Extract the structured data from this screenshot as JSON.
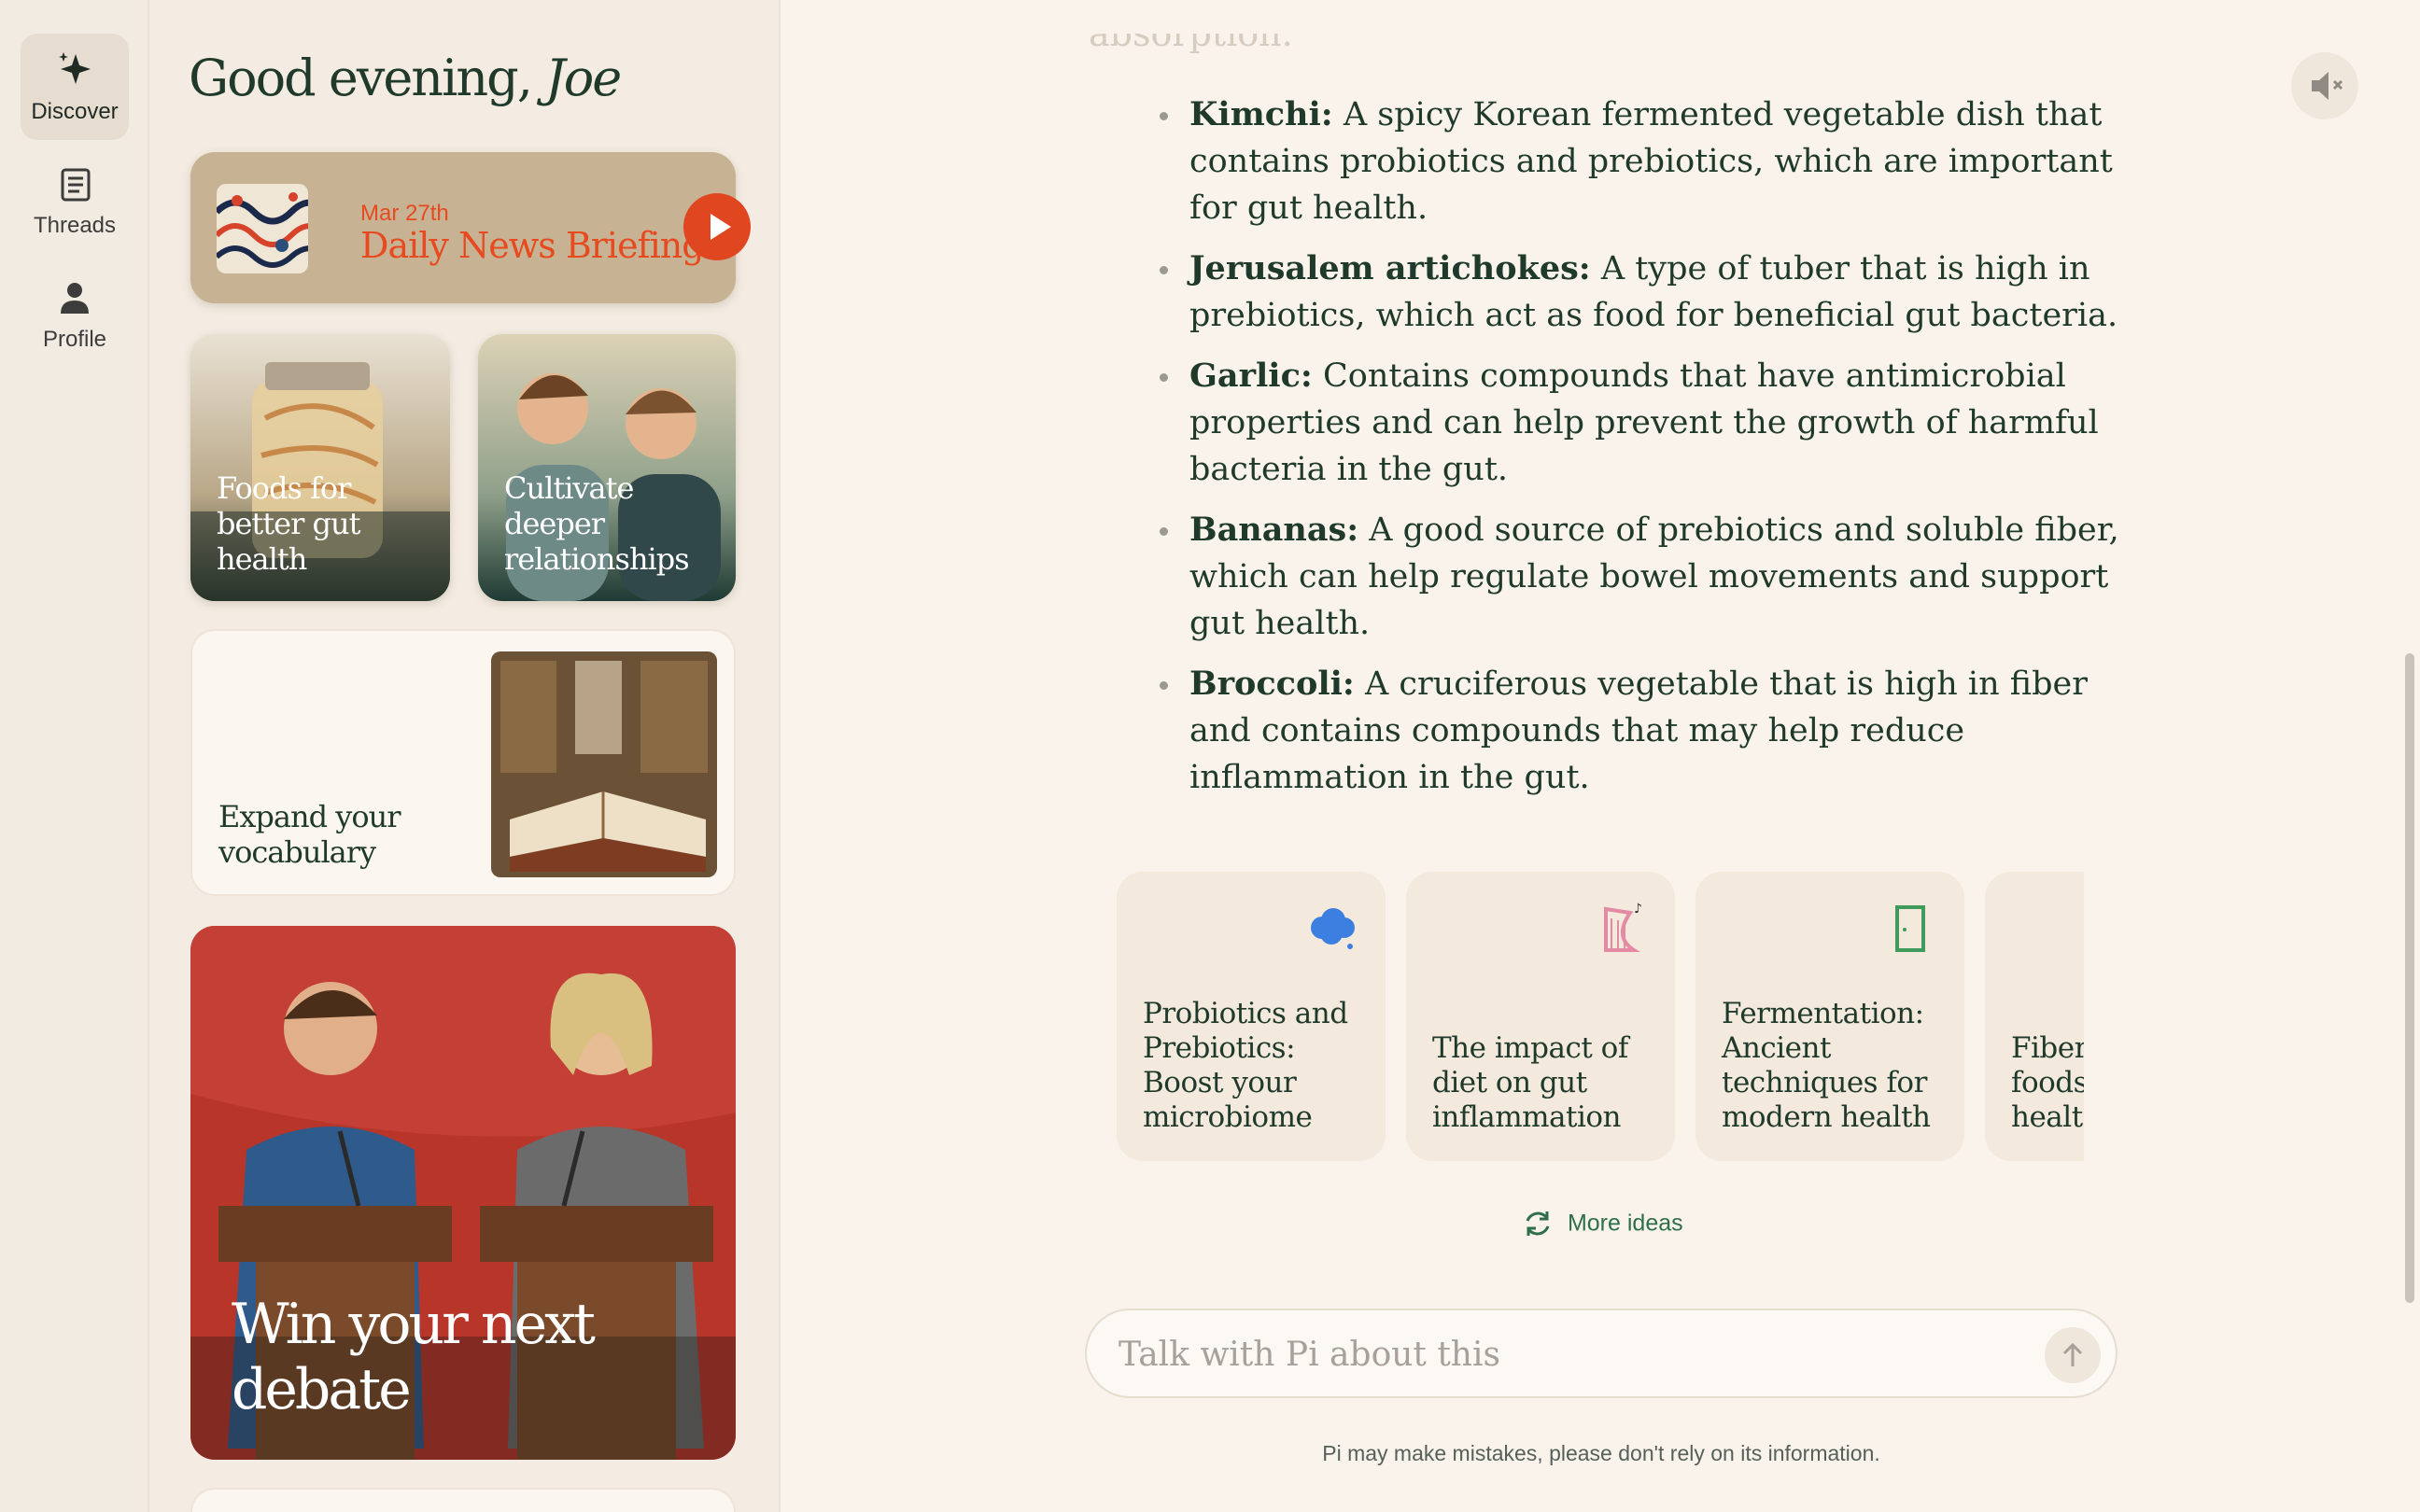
{
  "nav": {
    "items": [
      {
        "label": "Discover",
        "icon": "sparkle-icon",
        "active": true
      },
      {
        "label": "Threads",
        "icon": "threads-icon",
        "active": false
      },
      {
        "label": "Profile",
        "icon": "person-icon",
        "active": false
      }
    ]
  },
  "sidebar": {
    "greeting": "Good evening,",
    "user_name": "Joe",
    "news": {
      "date": "Mar 27th",
      "title": "Daily News Briefing"
    },
    "cards": {
      "gut": "Foods for better gut health",
      "relationships": "Cultivate deeper relationships",
      "vocabulary": "Expand your vocabulary",
      "debate": "Win your next debate"
    }
  },
  "main": {
    "faded_text": "absorption.",
    "bullets": [
      {
        "term": "Kimchi:",
        "text": " A spicy Korean fermented vegetable dish that contains probiotics and prebiotics, which are important for gut health."
      },
      {
        "term": "Jerusalem artichokes:",
        "text": " A type of tuber that is high in prebiotics, which act as food for beneficial gut bacteria."
      },
      {
        "term": "Garlic:",
        "text": " Contains compounds that have antimicrobial properties and can help prevent the growth of harmful bacteria in the gut."
      },
      {
        "term": "Bananas:",
        "text": " A good source of prebiotics and soluble fiber, which can help regulate bowel movements and support gut health."
      },
      {
        "term": "Broccoli:",
        "text": " A cruciferous vegetable that is high in fiber and contains compounds that may help reduce inflammation in the gut."
      }
    ],
    "ideas": [
      {
        "title": "Probiotics and Prebiotics: Boost your microbiome",
        "icon": "cloud-icon"
      },
      {
        "title": "The impact of diet on gut inflammation",
        "icon": "harp-icon"
      },
      {
        "title": "Fermentation: Ancient techniques for modern health",
        "icon": "door-icon"
      },
      {
        "title": "Fiber foods healt",
        "icon": ""
      }
    ],
    "more_ideas": "More ideas",
    "chat_placeholder": "Talk with Pi about this",
    "disclaimer": "Pi may make mistakes, please don't rely on its information."
  },
  "colors": {
    "accent_orange": "#e0461f",
    "text_green": "#1f3a2b",
    "link_green": "#2d6f4a",
    "background": "#faf3eb"
  }
}
